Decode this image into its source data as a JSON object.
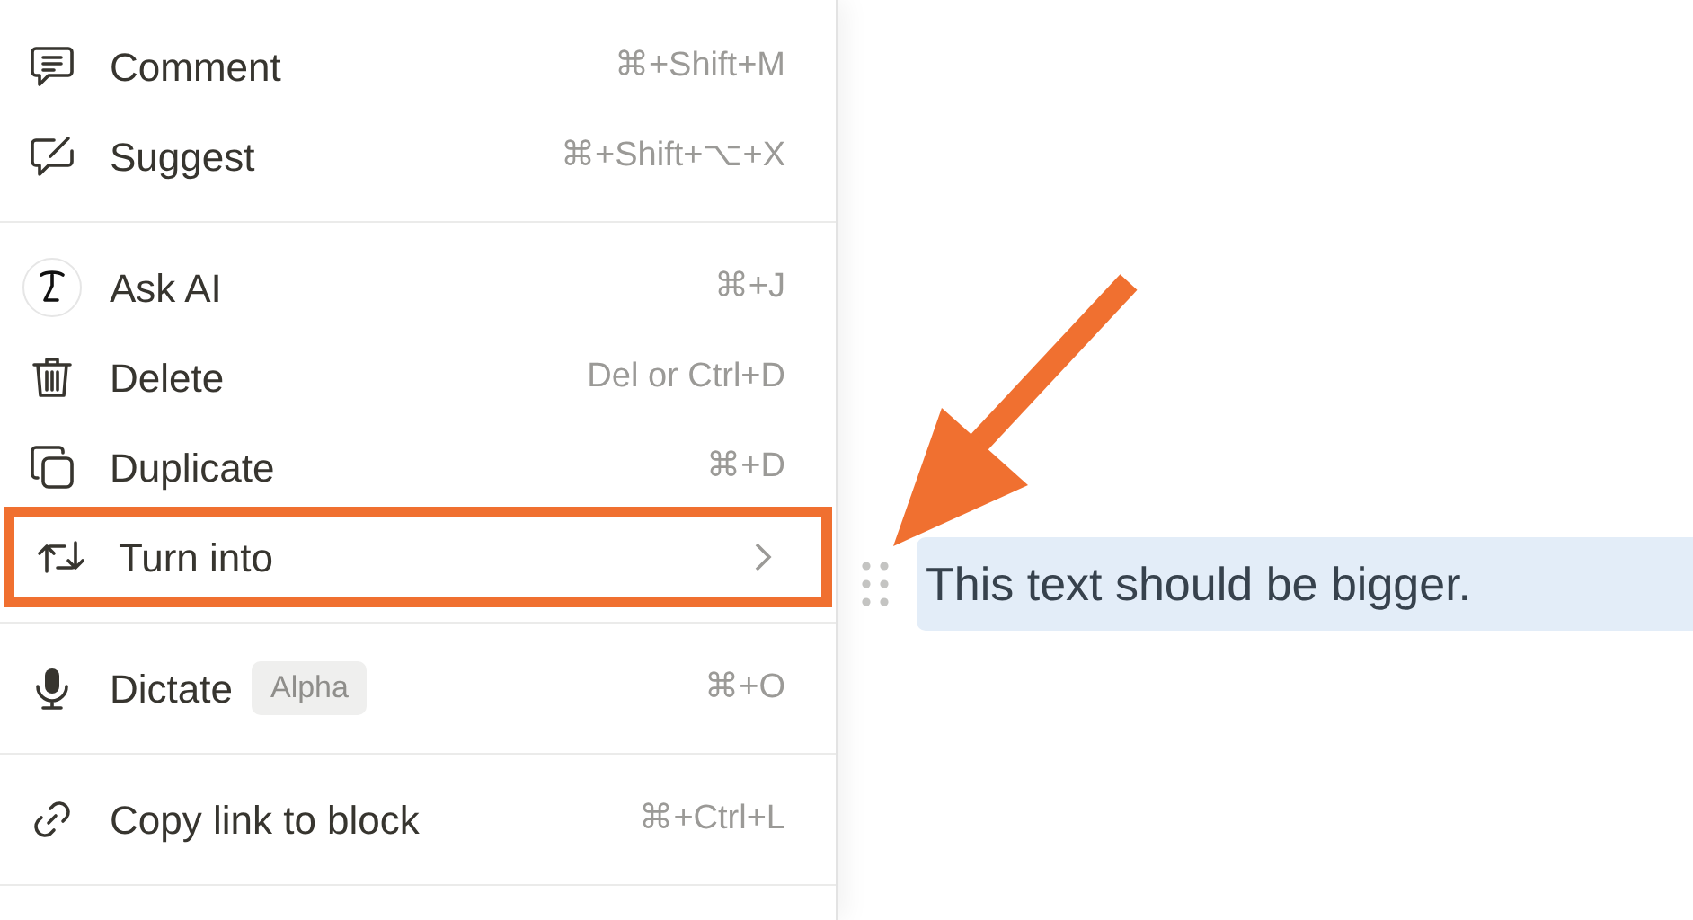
{
  "menu": {
    "groups": [
      {
        "items": [
          {
            "label": "Comment",
            "shortcut": "⌘+Shift+M",
            "submenu": false,
            "highlighted": false
          },
          {
            "label": "Suggest",
            "shortcut": "⌘+Shift+⌥+X",
            "submenu": false,
            "highlighted": false
          }
        ]
      },
      {
        "items": [
          {
            "label": "Ask AI",
            "shortcut": "⌘+J",
            "submenu": false,
            "highlighted": false
          },
          {
            "label": "Delete",
            "shortcut": "Del or Ctrl+D",
            "submenu": false,
            "highlighted": false
          },
          {
            "label": "Duplicate",
            "shortcut": "⌘+D",
            "submenu": false,
            "highlighted": false
          },
          {
            "label": "Turn into",
            "submenu": true,
            "highlighted": true
          }
        ]
      },
      {
        "items": [
          {
            "label": "Dictate",
            "badge": "Alpha",
            "shortcut": "⌘+O",
            "submenu": false,
            "highlighted": false
          }
        ]
      },
      {
        "items": [
          {
            "label": "Copy link to block",
            "shortcut": "⌘+Ctrl+L",
            "submenu": false,
            "highlighted": false
          }
        ]
      }
    ]
  },
  "editor": {
    "block": {
      "text": "This text should be bigger.",
      "selected": true
    }
  }
}
